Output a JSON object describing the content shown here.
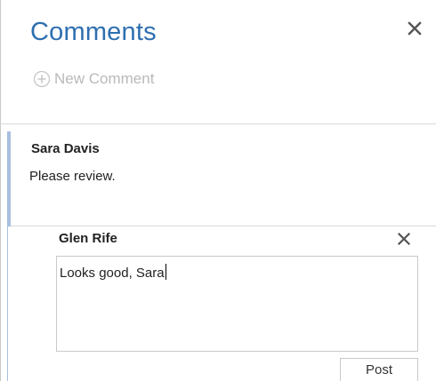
{
  "pane": {
    "title": "Comments",
    "close_icon": "close-icon",
    "new_comment_label": "New Comment",
    "new_comment_icon": "plus-circle-icon"
  },
  "thread": {
    "comment": {
      "author": "Sara Davis",
      "text": "Please review."
    },
    "reply": {
      "author": "Glen Rife",
      "text": "Looks good, Sara",
      "post_label": "Post",
      "close_icon": "close-icon"
    }
  },
  "colors": {
    "title": "#2e6fb0",
    "accent_bar": "#a9bfe0",
    "disabled_text": "#b9b9b9",
    "border": "#c9c9c9"
  }
}
